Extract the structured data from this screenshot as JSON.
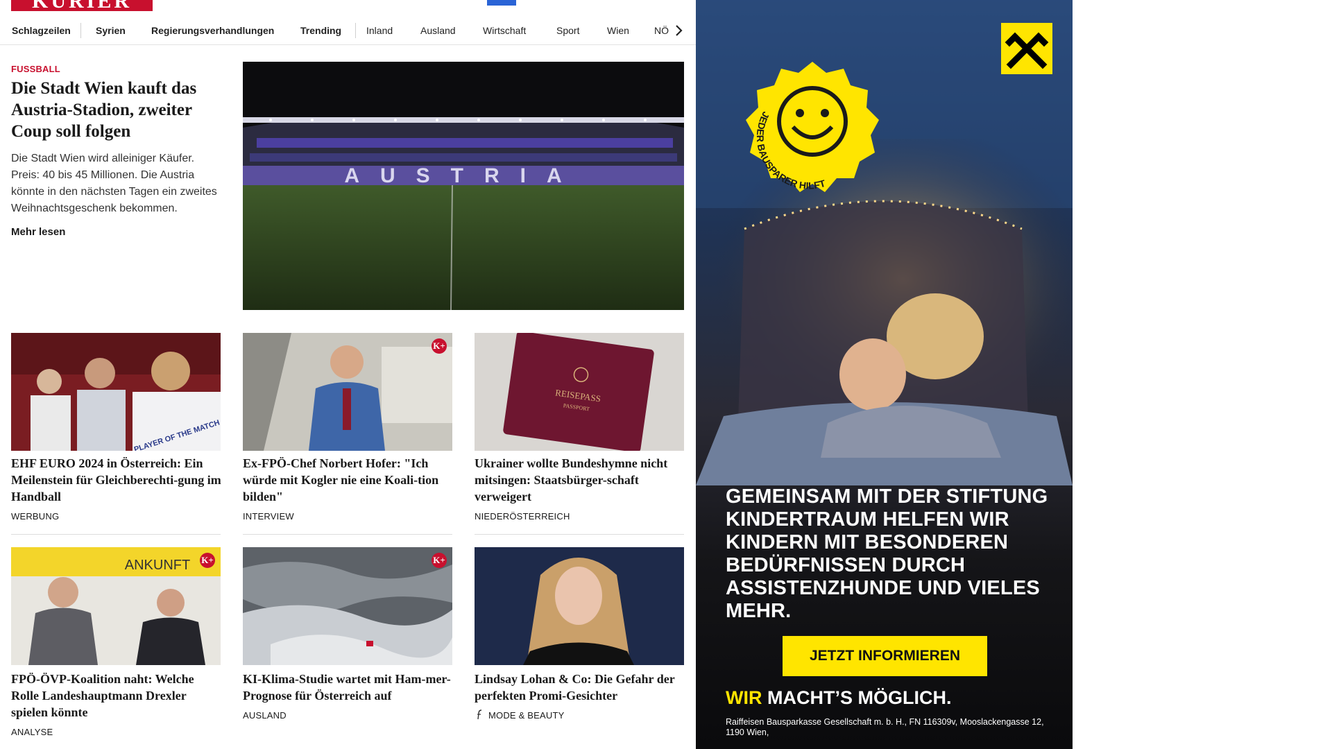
{
  "brand": {
    "logo_text": "KURIER",
    "accent": "#c8102e",
    "nav_blue": "#2a64d6"
  },
  "nav": {
    "items": [
      {
        "label": "Schlagzeilen"
      },
      {
        "label": "Syrien"
      },
      {
        "label": "Regierungsverhandlungen"
      },
      {
        "label": "Trending"
      },
      {
        "label": "Inland"
      },
      {
        "label": "Ausland"
      },
      {
        "label": "Wirtschaft"
      },
      {
        "label": "Sport"
      },
      {
        "label": "Wien"
      },
      {
        "label": "NÖ"
      }
    ],
    "more_icon": "chevron-right-icon"
  },
  "hero": {
    "kicker": "FUSSBALL",
    "title": "Die Stadt Wien kauft das Austria-Stadion, zweiter Coup soll folgen",
    "teaser": "Die Stadt Wien wird alleiniger Käufer. Preis: 40 bis 45 Millionen. Die Austria könnte in den nächsten Tagen ein zweites Weihnachtsgeschenk bekommen.",
    "more": "Mehr lesen",
    "image_text": "AUSTRIA"
  },
  "cards": [
    {
      "title": "EHF EURO 2024 in Österreich: Ein Meilenstein für Gleichberechti-gung im Handball",
      "category": "WERBUNG",
      "premium": false
    },
    {
      "title": "Ex-FPÖ-Chef Norbert Hofer: \"Ich würde mit Kogler nie eine Koali-tion bilden\"",
      "category": "INTERVIEW",
      "premium": true
    },
    {
      "title": "Ukrainer wollte Bundeshymne nicht mitsingen: Staatsbürger-schaft verweigert",
      "category": "NIEDERÖSTERREICH",
      "premium": false
    },
    {
      "title": "FPÖ-ÖVP-Koalition naht: Welche Rolle Landeshauptmann Drexler spielen könnte",
      "category": "ANALYSE",
      "premium": true
    },
    {
      "title": "KI-Klima-Studie wartet mit Ham-mer-Prognose für Österreich auf",
      "category": "AUSLAND",
      "premium": true
    },
    {
      "title": "Lindsay Lohan & Co: Die Gefahr der perfekten Promi-Gesichter",
      "category": "MODE & BEAUTY",
      "premium": false
    }
  ],
  "card_image_text": {
    "passport_line1": "REISEPASS",
    "passport_line2": "PASSPORT",
    "arrival_sign": "ANKUNFT",
    "shirt_text": "PLAYER OF THE MATCH",
    "premium_badge": "K+"
  },
  "ad": {
    "badge_text": "JEDER BAUSPARER HILFT",
    "body": "Gemeinsam mit der Stiftung Kindertraum helfen wir Kindern mit besonderen Bedürfnissen durch Assistenzhunde und vieles mehr.",
    "cta": "JETZT INFORMIEREN",
    "slogan_highlight": "WIR",
    "slogan_rest": "MACHT’S MÖGLICH.",
    "legal": "Raiffeisen Bausparkasse Gesellschaft m. b. H., FN 116309v, Mooslackengasse 12, 1190 Wien,",
    "accent": "#ffe500"
  }
}
